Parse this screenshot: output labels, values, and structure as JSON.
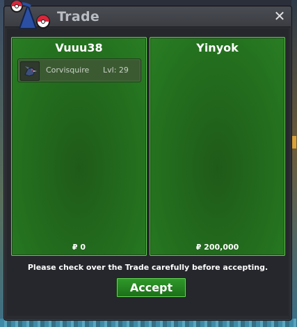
{
  "window": {
    "title": "Trade",
    "close_label": "✕"
  },
  "left_panel": {
    "player": "Vuuu38",
    "items": [
      {
        "name": "Corvisquire",
        "level": "Lvl: 29",
        "icon": "corvisquire-sprite-icon"
      }
    ],
    "money": "₽ 0"
  },
  "right_panel": {
    "player": "Yinyok",
    "money": "₽ 200,000"
  },
  "notice": "Please check over the Trade carefully before accepting.",
  "accept_label": "Accept",
  "colors": {
    "panel_green": "#24721f",
    "panel_border": "#5fcf4c",
    "button_green": "#2f9a2a"
  }
}
